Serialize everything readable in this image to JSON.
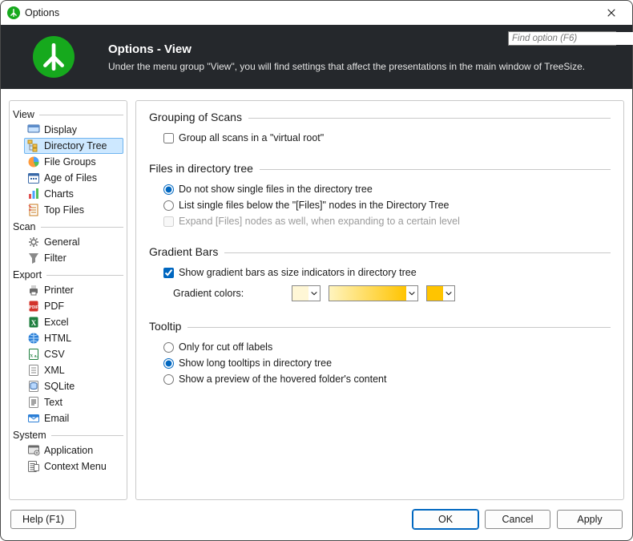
{
  "window": {
    "title": "Options"
  },
  "header": {
    "title": "Options - View",
    "description": "Under the menu group \"View\", you will find settings that affect the presentations in the main window of TreeSize.",
    "search_placeholder": "Find option (F6)"
  },
  "sidebar": {
    "groups": [
      {
        "label": "View",
        "items": [
          {
            "label": "Display",
            "icon": "display"
          },
          {
            "label": "Directory Tree",
            "icon": "tree",
            "selected": true
          },
          {
            "label": "File Groups",
            "icon": "pie"
          },
          {
            "label": "Age of Files",
            "icon": "calendar"
          },
          {
            "label": "Charts",
            "icon": "barchart"
          },
          {
            "label": "Top Files",
            "icon": "topfiles"
          }
        ]
      },
      {
        "label": "Scan",
        "items": [
          {
            "label": "General",
            "icon": "gear"
          },
          {
            "label": "Filter",
            "icon": "funnel"
          }
        ]
      },
      {
        "label": "Export",
        "items": [
          {
            "label": "Printer",
            "icon": "printer"
          },
          {
            "label": "PDF",
            "icon": "pdf"
          },
          {
            "label": "Excel",
            "icon": "excel"
          },
          {
            "label": "HTML",
            "icon": "html"
          },
          {
            "label": "CSV",
            "icon": "csv"
          },
          {
            "label": "XML",
            "icon": "xml"
          },
          {
            "label": "SQLite",
            "icon": "sqlite"
          },
          {
            "label": "Text",
            "icon": "text"
          },
          {
            "label": "Email",
            "icon": "email"
          }
        ]
      },
      {
        "label": "System",
        "items": [
          {
            "label": "Application",
            "icon": "application"
          },
          {
            "label": "Context Menu",
            "icon": "contextmenu"
          }
        ]
      }
    ]
  },
  "main": {
    "sections": {
      "grouping": {
        "title": "Grouping of Scans",
        "group_all_label": "Group all scans in a \"virtual root\"",
        "group_all_checked": false
      },
      "files": {
        "title": "Files in directory tree",
        "opt1": "Do not show single files in the directory tree",
        "opt2": "List single files below the \"[Files]\" nodes in the Directory Tree",
        "expand_label": "Expand [Files] nodes as well, when expanding to a certain level",
        "selected": "opt1",
        "expand_checked": false,
        "expand_disabled": true
      },
      "gradient": {
        "title": "Gradient Bars",
        "show_label": "Show gradient bars as size indicators in directory tree",
        "show_checked": true,
        "colors_label": "Gradient colors:",
        "color1": "#fff7d6",
        "gradient_from": "#fff4bf",
        "gradient_to": "#ffc400",
        "color2": "#ffc400"
      },
      "tooltip": {
        "title": "Tooltip",
        "opt1": "Only for cut off labels",
        "opt2": "Show long tooltips in directory tree",
        "opt3": "Show a preview of the hovered folder's content",
        "selected": "opt2"
      }
    }
  },
  "footer": {
    "help": "Help (F1)",
    "ok": "OK",
    "cancel": "Cancel",
    "apply": "Apply"
  },
  "icons": {
    "display": "display-icon",
    "tree": "tree-icon",
    "pie": "pie-icon",
    "calendar": "calendar-icon",
    "barchart": "barchart-icon",
    "topfiles": "topfiles-icon",
    "gear": "gear-icon",
    "funnel": "funnel-icon",
    "printer": "printer-icon",
    "pdf": "pdf-icon",
    "excel": "excel-icon",
    "html": "html-icon",
    "csv": "csv-icon",
    "xml": "xml-icon",
    "sqlite": "sqlite-icon",
    "text": "text-icon",
    "email": "email-icon",
    "application": "application-icon",
    "contextmenu": "contextmenu-icon"
  }
}
